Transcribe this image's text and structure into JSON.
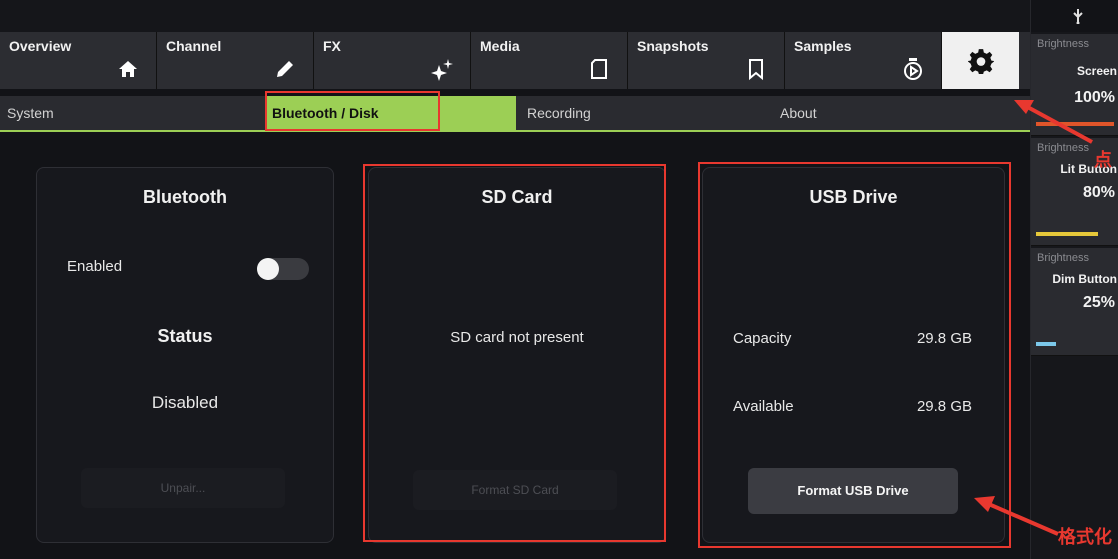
{
  "tabs": [
    {
      "label": "Overview",
      "icon": "home-icon"
    },
    {
      "label": "Channel",
      "icon": "pencil-icon"
    },
    {
      "label": "FX",
      "icon": "sparkle-icon"
    },
    {
      "label": "Media",
      "icon": "sd-card-icon"
    },
    {
      "label": "Snapshots",
      "icon": "bookmark-icon"
    },
    {
      "label": "Samples",
      "icon": "sample-pad-icon"
    }
  ],
  "settings_tab": {
    "icon": "gear-icon"
  },
  "subtabs": [
    "System",
    "Bluetooth / Disk",
    "Recording",
    "About"
  ],
  "bluetooth": {
    "title": "Bluetooth",
    "enabled_label": "Enabled",
    "status_title": "Status",
    "status_value": "Disabled",
    "unpair_button": "Unpair..."
  },
  "sd_card": {
    "title": "SD Card",
    "message": "SD card not present",
    "format_button": "Format SD Card"
  },
  "usb": {
    "title": "USB Drive",
    "capacity_label": "Capacity",
    "capacity_value": "29.8 GB",
    "available_label": "Available",
    "available_value": "29.8 GB",
    "format_button": "Format USB Drive"
  },
  "sidebar": {
    "screen": {
      "caption": "Brightness",
      "name": "Screen",
      "value": "100%",
      "level": 1.0,
      "color": "#e0552a"
    },
    "lit": {
      "caption": "Brightness",
      "name": "Lit Button",
      "value": "80%",
      "level": 0.8,
      "color": "#e6c83a"
    },
    "dim": {
      "caption": "Brightness",
      "name": "Dim Button",
      "value": "25%",
      "level": 0.25,
      "color": "#7cc8ea"
    }
  },
  "annotations": {
    "click_note": "点",
    "format_note": "格式化"
  },
  "colors": {
    "accent": "#9ccf55",
    "highlight": "#e8382f"
  }
}
